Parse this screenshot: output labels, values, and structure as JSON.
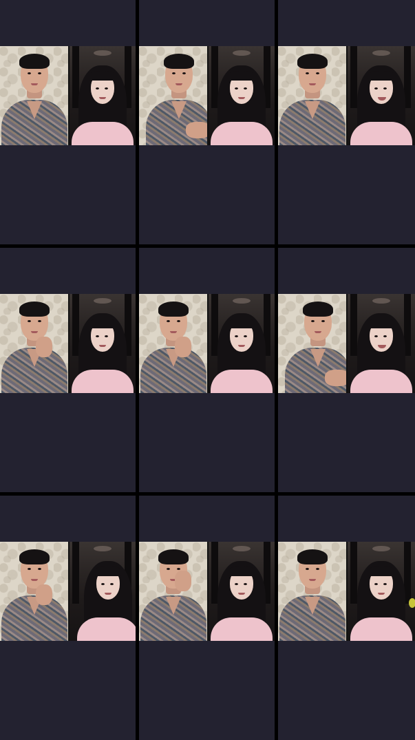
{
  "layout": {
    "columns": 3,
    "rows": 3,
    "cell_count": 9
  },
  "colors": {
    "gutter": "#000000",
    "tile_background": "#232230",
    "wallpaper": "#ddd6c8",
    "hallway": "#1e1a1a",
    "sweater": "#6d6a76",
    "pink_top": "#eec3cc"
  },
  "tiles": [
    {
      "name": "tile-1",
      "left_pose": "smiling",
      "right_pose": "neutral"
    },
    {
      "name": "tile-2",
      "left_pose": "reaching",
      "right_pose": "talking"
    },
    {
      "name": "tile-3",
      "left_pose": "smiling",
      "right_pose": "laughing"
    },
    {
      "name": "tile-4",
      "left_pose": "hand-on-chin",
      "right_pose": "talking"
    },
    {
      "name": "tile-5",
      "left_pose": "hand-on-chin",
      "right_pose": "smiling"
    },
    {
      "name": "tile-6",
      "left_pose": "reaching",
      "right_pose": "laughing"
    },
    {
      "name": "tile-7",
      "left_pose": "hand-on-chin",
      "right_pose": "moving"
    },
    {
      "name": "tile-8",
      "left_pose": "hand-near-face",
      "right_pose": "smiling"
    },
    {
      "name": "tile-9",
      "left_pose": "smiling",
      "right_pose": "neutral"
    }
  ]
}
